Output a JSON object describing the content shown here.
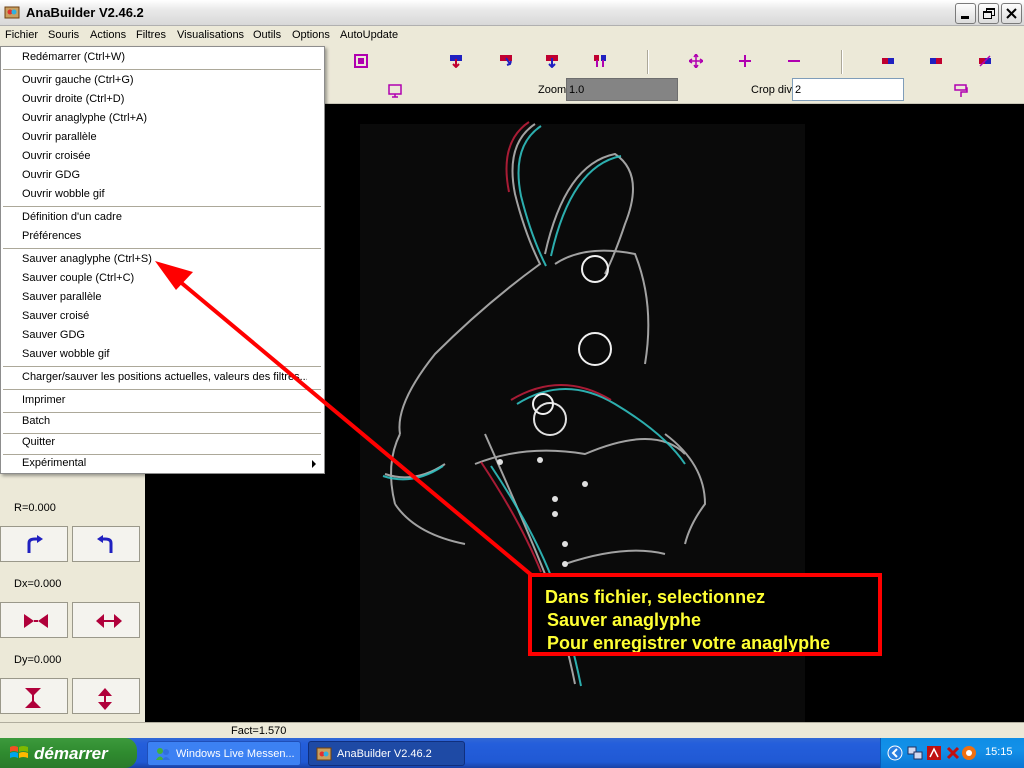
{
  "window": {
    "title": "AnaBuilder V2.46.2"
  },
  "menubar": {
    "items": [
      "Fichier",
      "Souris",
      "Actions",
      "Filtres",
      "Visualisations",
      "Outils",
      "Options",
      "AutoUpdate"
    ]
  },
  "dropdown": {
    "items": [
      "Redémarrer (Ctrl+W)",
      "Ouvrir gauche (Ctrl+G)",
      "Ouvrir droite (Ctrl+D)",
      "Ouvrir anaglyphe (Ctrl+A)",
      "Ouvrir parallèle",
      "Ouvrir croisée",
      "Ouvrir GDG",
      "Ouvrir wobble gif",
      "Définition d'un cadre",
      "Préférences",
      "Sauver anaglyphe (Ctrl+S)",
      "Sauver couple (Ctrl+C)",
      "Sauver parallèle",
      "Sauver croisé",
      "Sauver GDG",
      "Sauver wobble gif",
      "Charger/sauver les positions actuelles, valeurs des filtres...",
      "Imprimer",
      "Batch",
      "Quitter",
      "Expérimental"
    ]
  },
  "toolbar": {
    "zoom_label": "Zoom",
    "zoom_value": "1.0",
    "crop_label": "Crop div",
    "crop_value": "2"
  },
  "left_panel": {
    "r_label": "R=0.000",
    "dx_label": "Dx=0.000",
    "dy_label": "Dy=0.000"
  },
  "status": {
    "fact": "Fact=1.570"
  },
  "annotation": {
    "line1": "Dans fichier, selectionnez",
    "line2": "Sauver anaglyphe",
    "line3": "Pour enregistrer votre anaglyphe"
  },
  "taskbar": {
    "start_label": "démarrer",
    "tasks": [
      "Windows Live Messen...",
      "AnaBuilder V2.46.2"
    ],
    "clock": "15:15"
  },
  "colors": {
    "accent_red": "#ff0000",
    "annotation_text": "#ffff33",
    "icon_magenta": "#b000b0",
    "icon_blue": "#2020c0"
  }
}
